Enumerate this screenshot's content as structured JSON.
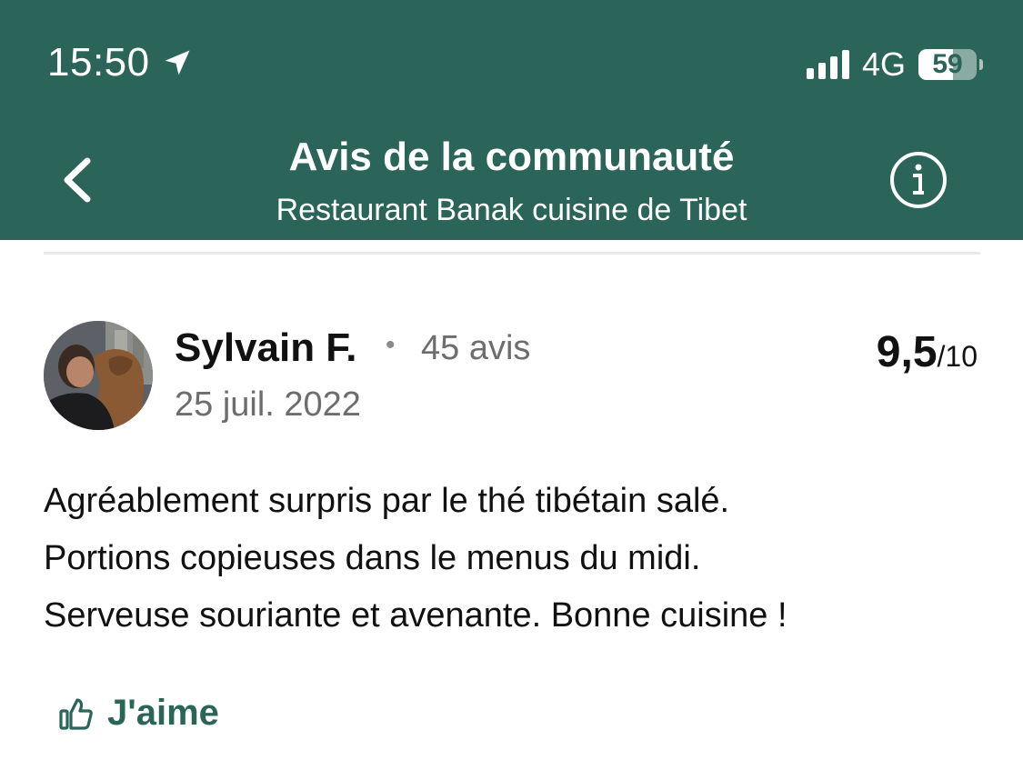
{
  "status_bar": {
    "time": "15:50",
    "network": "4G",
    "battery": "59",
    "battery_level": 0.59
  },
  "header": {
    "title": "Avis de la communauté",
    "subtitle": "Restaurant Banak cuisine de Tibet",
    "back_icon": "chevron-left-icon",
    "info_icon": "info-icon",
    "background_color": "#2b6459"
  },
  "review": {
    "author": "Sylvain F.",
    "separator": "•",
    "review_count": "45 avis",
    "date": "25 juil. 2022",
    "rating": "9,5",
    "rating_max": "/10",
    "lines": [
      "Agréablement surpris par le thé tibétain salé.",
      "Portions copieuses dans le menus du midi.",
      "Serveuse souriante et avenante. Bonne cuisine !"
    ]
  },
  "actions": {
    "like_label": "J'aime",
    "like_icon": "thumbs-up-icon",
    "accent_color": "#2b6459"
  }
}
